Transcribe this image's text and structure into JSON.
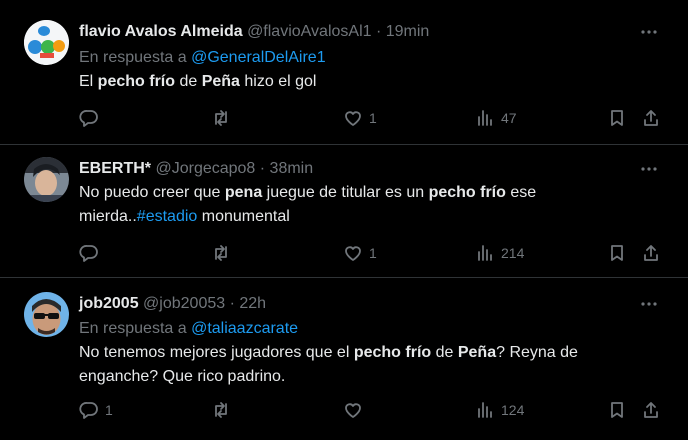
{
  "tweets": [
    {
      "name": "flavio Avalos Almeida",
      "handle": "@flavioAvalosAl1",
      "time": "19min",
      "reply_label": "En respuesta a",
      "reply_handle": "@GeneralDelAire1",
      "text": [
        {
          "t": "El ",
          "s": "n"
        },
        {
          "t": "pecho frío",
          "s": "b"
        },
        {
          "t": " de ",
          "s": "n"
        },
        {
          "t": "Peña",
          "s": "b"
        },
        {
          "t": " hizo el gol",
          "s": "n"
        }
      ],
      "replies": "",
      "retweets": "",
      "likes": "1",
      "views": "47"
    },
    {
      "name": "EBERTH*",
      "handle": "@Jorgecapo8",
      "time": "38min",
      "text": [
        {
          "t": "No puedo creer que ",
          "s": "n"
        },
        {
          "t": "pena",
          "s": "b"
        },
        {
          "t": " juegue de titular es un ",
          "s": "n"
        },
        {
          "t": "pecho frío",
          "s": "b"
        },
        {
          "t": " ese mierda..",
          "s": "n"
        },
        {
          "t": "#estadio",
          "s": "tag"
        },
        {
          "t": " monumental",
          "s": "n"
        }
      ],
      "replies": "",
      "retweets": "",
      "likes": "1",
      "views": "214"
    },
    {
      "name": "job2005",
      "handle": "@job20053",
      "time": "22h",
      "reply_label": "En respuesta a",
      "reply_handle": "@taliaazcarate",
      "text": [
        {
          "t": "No tenemos mejores jugadores que el ",
          "s": "n"
        },
        {
          "t": "pecho frío",
          "s": "b"
        },
        {
          "t": " de ",
          "s": "n"
        },
        {
          "t": "Peña",
          "s": "b"
        },
        {
          "t": "? Reyna de enganche? Que rico padrino.",
          "s": "n"
        }
      ],
      "replies": "1",
      "retweets": "",
      "likes": "",
      "views": "124"
    }
  ],
  "sep": " · ",
  "icons": [
    "reply-icon",
    "retweet-icon",
    "like-icon",
    "views-icon",
    "bookmark-icon",
    "share-icon",
    "more-icon"
  ],
  "colors": {
    "background": "#000000",
    "text": "#e7e9ea",
    "muted": "#71767b",
    "link": "#1d9bf0",
    "border": "#2f3336"
  }
}
